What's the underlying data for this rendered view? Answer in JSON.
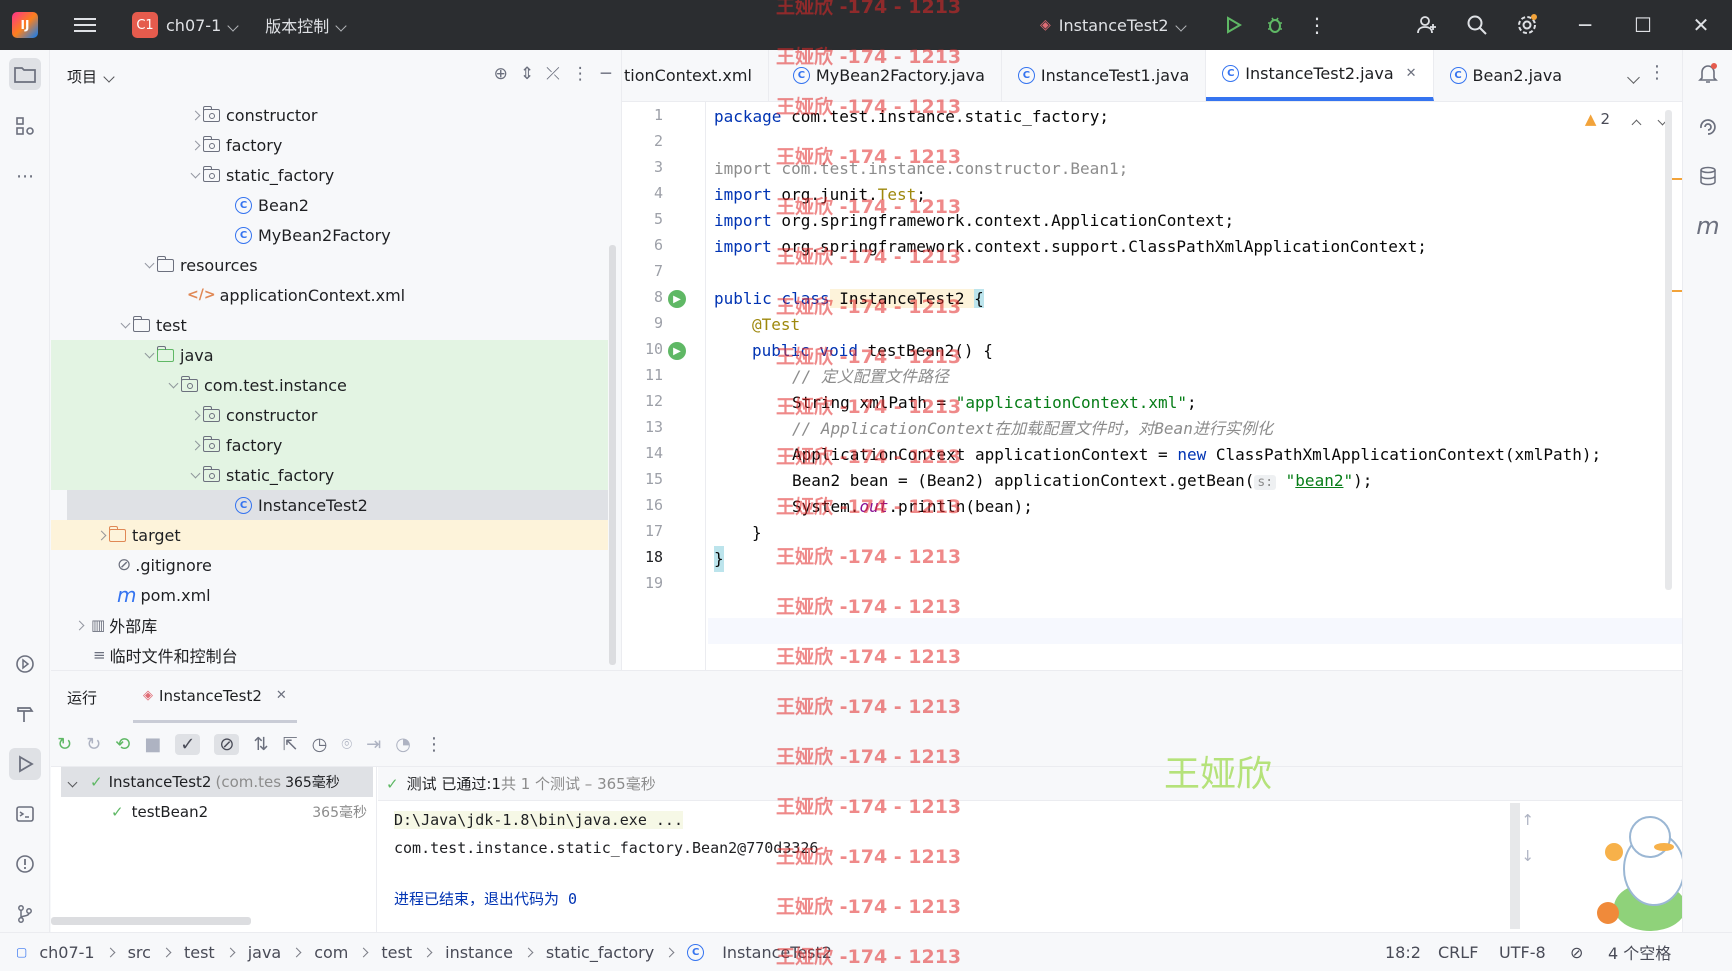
{
  "titlebar": {
    "project_badge": "C1",
    "project_name": "ch07-1",
    "vcs": "版本控制",
    "run_config": "InstanceTest2"
  },
  "project_panel": {
    "title": "项目",
    "tree": [
      {
        "label": "constructor",
        "icon": "package-folder"
      },
      {
        "label": "factory",
        "icon": "package-folder"
      },
      {
        "label": "static_factory",
        "icon": "package-folder"
      },
      {
        "label": "Bean2",
        "icon": "class"
      },
      {
        "label": "MyBean2Factory",
        "icon": "class"
      },
      {
        "label": "resources",
        "icon": "resources-folder"
      },
      {
        "label": "applicationContext.xml",
        "icon": "xml-file"
      },
      {
        "label": "test",
        "icon": "folder"
      },
      {
        "label": "java",
        "icon": "test-source-folder"
      },
      {
        "label": "com.test.instance",
        "icon": "package-folder"
      },
      {
        "label": "constructor",
        "icon": "package-folder"
      },
      {
        "label": "factory",
        "icon": "package-folder"
      },
      {
        "label": "static_factory",
        "icon": "package-folder"
      },
      {
        "label": "InstanceTest2",
        "icon": "class"
      },
      {
        "label": "target",
        "icon": "excluded-folder"
      },
      {
        "label": ".gitignore",
        "icon": "ignore-file"
      },
      {
        "label": "pom.xml",
        "icon": "maven-file"
      },
      {
        "label": "外部库",
        "icon": "library"
      },
      {
        "label": "临时文件和控制台",
        "icon": "scratches"
      }
    ]
  },
  "editor": {
    "tabs": [
      "tionContext.xml",
      "MyBean2Factory.java",
      "InstanceTest1.java",
      "InstanceTest2.java",
      "Bean2.java"
    ],
    "warning_count": "2",
    "line_numbers": [
      "1",
      "2",
      "3",
      "4",
      "5",
      "6",
      "7",
      "8",
      "9",
      "10",
      "11",
      "12",
      "13",
      "14",
      "15",
      "16",
      "17",
      "18",
      "19"
    ],
    "code": {
      "l1_kw": "package",
      "l1_rest": " com.test.instance.static_factory;",
      "l3_kw": "import",
      "l3_rest": " com.test.instance.constructor.Bean1;",
      "l4_kw": "import",
      "l4_a": " org.junit.",
      "l4_b": "Test",
      "l4_c": ";",
      "l5_kw": "import",
      "l5_rest": " org.springframework.context.ApplicationContext;",
      "l6_kw": "import",
      "l6_rest": " org.springframework.context.support.ClassPathXmlApplicationContext;",
      "l8_kw": "public class",
      "l8_name": " InstanceTest2 ",
      "l8_brace": "{",
      "l9": "@Test",
      "l10_kw": "public void",
      "l10_rest": " testBean2() {",
      "l11": "// 定义配置文件路径",
      "l12_a": "String xmlPath = ",
      "l12_str": "\"applicationContext.xml\"",
      "l12_c": ";",
      "l13": "// ApplicationContext在加载配置文件时，对Bean进行实例化",
      "l14_a": "ApplicationContext applicationContext = ",
      "l14_kw": "new",
      "l14_b": " ClassPathXmlApplicationContext(xmlPath);",
      "l15_a": "Bean2 bean = (Bean2) applicationContext.getBean(",
      "l15_hint": "s:",
      "l15_str_a": " \"",
      "l15_str_b": "bean2",
      "l15_str_c": "\"",
      "l15_c": ");",
      "l16_a": "System.",
      "l16_out": "out",
      "l16_b": ".println(bean);",
      "l17": "}",
      "l18": "}"
    }
  },
  "run_panel": {
    "title": "运行",
    "tab": "InstanceTest2",
    "tests": [
      {
        "name": "InstanceTest2",
        "detail": "(com.tes",
        "time": "365毫秒"
      },
      {
        "name": "testBean2",
        "time": "365毫秒"
      }
    ],
    "status_a": "测试 已通过: ",
    "status_b": "1",
    "status_c": "共 1 个测试 – 365毫秒",
    "console": [
      "D:\\Java\\jdk-1.8\\bin\\java.exe ...",
      "com.test.instance.static_factory.Bean2@770d3326",
      "进程已结束，退出代码为 0"
    ]
  },
  "statusbar": {
    "breadcrumbs": [
      "ch07-1",
      "src",
      "test",
      "java",
      "com",
      "test",
      "instance",
      "static_factory",
      "InstanceTest2"
    ],
    "position": "18:2",
    "line_sep": "CRLF",
    "encoding": "UTF-8",
    "indent": "4 个空格"
  },
  "watermark": {
    "text": "王娅欣 -174 - 1213",
    "big": "王娅欣"
  }
}
